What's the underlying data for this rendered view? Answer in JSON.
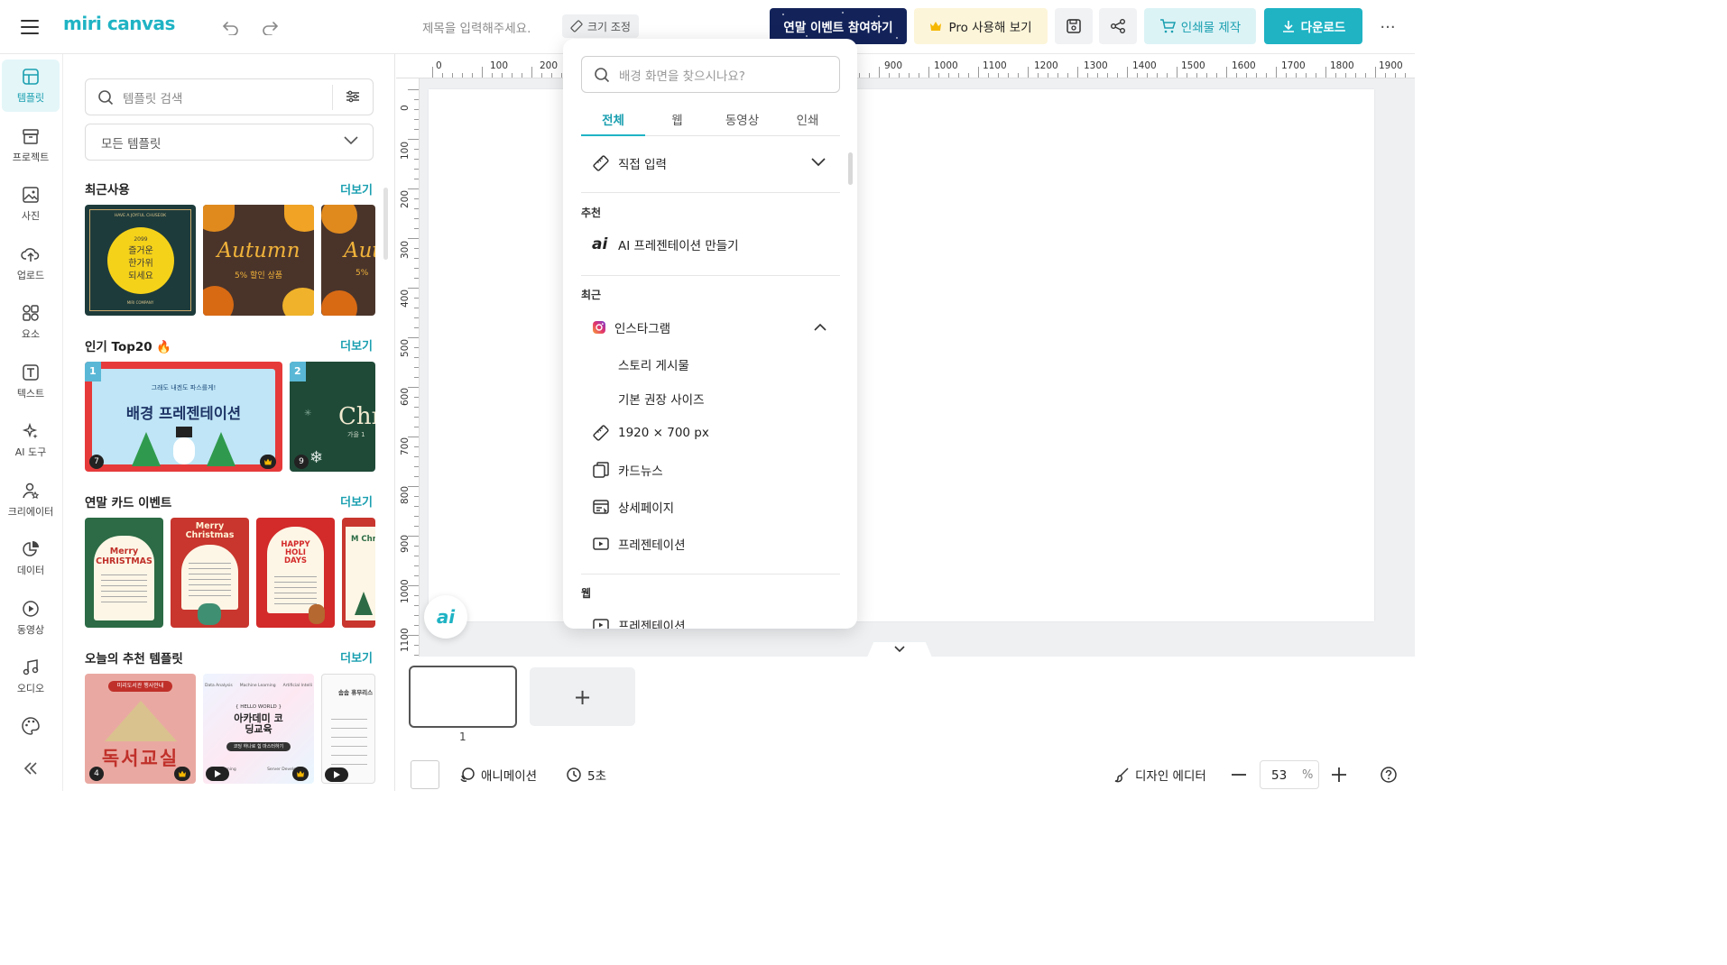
{
  "app": {
    "logo": "miri canvas",
    "doc_title_placeholder": "제목을 입력해주세요.",
    "resize_label": "크기 조정",
    "event_label": "연말 이벤트 참여하기",
    "pro_label": "Pro 사용해 보기",
    "print_label": "인쇄물 제작",
    "download_label": "다운로드",
    "more_label": "···"
  },
  "colors": {
    "accent": "#1fb3c4",
    "event_bg": "#13235a",
    "pro_bg": "#fdf5d9"
  },
  "rail": [
    {
      "label": "템플릿",
      "icon": "template-icon",
      "active": true
    },
    {
      "label": "프로젝트",
      "icon": "project-icon"
    },
    {
      "label": "사진",
      "icon": "photo-icon"
    },
    {
      "label": "업로드",
      "icon": "upload-icon"
    },
    {
      "label": "요소",
      "icon": "elements-icon"
    },
    {
      "label": "텍스트",
      "icon": "text-icon"
    },
    {
      "label": "AI 도구",
      "icon": "ai-tools-icon"
    },
    {
      "label": "크리에이터",
      "icon": "creator-icon"
    },
    {
      "label": "데이터",
      "icon": "data-icon"
    },
    {
      "label": "동영상",
      "icon": "video-icon"
    },
    {
      "label": "오디오",
      "icon": "audio-icon"
    }
  ],
  "panel": {
    "search_placeholder": "템플릿 검색",
    "category_selected": "모든 템플릿",
    "more": "더보기",
    "sections": [
      {
        "title": "최근사용"
      },
      {
        "title": "인기 Top20 🔥"
      },
      {
        "title": "연말 카드 이벤트"
      },
      {
        "title": "오늘의 추천 템플릿"
      }
    ],
    "recent": [
      {
        "lines": [
          "2099",
          "즐거운",
          "한가위",
          "되세요"
        ],
        "top": "HAVE A JOYFUL CHUSEOK",
        "bottom": "MIRI COMPANY"
      },
      {
        "title": "Autumn",
        "sub": "5% 할인 상품"
      },
      {
        "title": "Aut",
        "sub": "5%"
      }
    ],
    "top20": [
      {
        "rank": "1",
        "title": "배경 프레젠테이션",
        "small": "그래도 내겐도 파스를게!",
        "count": "7"
      },
      {
        "rank": "2",
        "title": "Chr",
        "sub": "가을 1",
        "count": "9"
      }
    ],
    "cards": [
      {
        "title": "Merry CHRISTMAS"
      },
      {
        "title": "Merry Christmas"
      },
      {
        "title": "HAPPY HOLI DAYS"
      },
      {
        "title": "M Chr"
      }
    ],
    "today": [
      {
        "top": "미리도서관 행사안내",
        "title": "독서교실",
        "count": "4"
      },
      {
        "tags": [
          "Data Analysis",
          "Machine Learning",
          "Artificial Intelli"
        ],
        "hello": "{ HELLO WORLD }",
        "title": "아카데미 코딩교육",
        "cta": "코딩 하나로 힙 마스터하기",
        "foot": [
          "Learning",
          "Server Develop"
        ]
      },
      {
        "top": "솜솜 휴무리스"
      }
    ]
  },
  "ruler": {
    "top": [
      "0",
      "100",
      "200",
      "900",
      "1000",
      "1100",
      "1200",
      "1300",
      "1400",
      "1500",
      "1600",
      "1700",
      "1800",
      "1900"
    ],
    "left": [
      "0",
      "100",
      "200",
      "300",
      "400",
      "500",
      "600",
      "700",
      "800",
      "900",
      "1000",
      "1100"
    ]
  },
  "dropdown": {
    "search_placeholder": "배경 화면을 찾으시나요?",
    "tabs": [
      "전체",
      "웹",
      "동영상",
      "인쇄"
    ],
    "custom_input": "직접 입력",
    "recommend_head": "추천",
    "ai_presentation": "AI 프레젠테이션 만들기",
    "recent_head": "최근",
    "instagram": "인스타그램",
    "story": "스토리 게시물",
    "basic_size": "기본 권장 사이즈",
    "custom_size": "1920 × 700 px",
    "cardnews": "카드뉴스",
    "detail_page": "상세페이지",
    "presentation": "프레젠테이션",
    "web_head": "웹",
    "web_presentation": "프레젠테이션"
  },
  "pages": {
    "page_number": "1",
    "add": "+"
  },
  "bottom": {
    "animation": "애니메이션",
    "duration": "5초",
    "design_editor": "디자인 에디터",
    "zoom": "53",
    "zoom_unit": "%",
    "ai_fab": "ai"
  }
}
